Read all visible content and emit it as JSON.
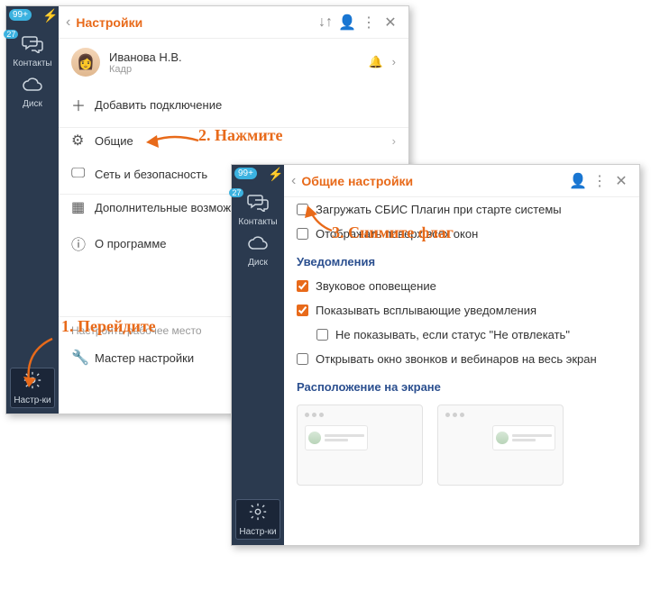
{
  "win1": {
    "badge": "99+",
    "sidebar": {
      "contacts": {
        "count": "27",
        "label": "Контакты"
      },
      "disk": {
        "label": "Диск"
      },
      "settings": {
        "label": "Настр-ки"
      }
    },
    "title": "Настройки",
    "user": {
      "name": "Иванова Н.В.",
      "dept": "Кадр"
    },
    "items": {
      "add_conn": "Добавить подключение",
      "general": "Общие",
      "net_sec": "Сеть и безопасность",
      "extra": "Дополнительные возможности",
      "about": "О программе"
    },
    "hint": "Настроить рабочее место",
    "wizard": "Мастер настройки"
  },
  "win2": {
    "badge": "99+",
    "sidebar": {
      "contacts": {
        "count": "27",
        "label": "Контакты"
      },
      "disk": {
        "label": "Диск"
      },
      "settings": {
        "label": "Настр-ки"
      }
    },
    "title": "Общие настройки",
    "opts": {
      "load_on_start": "Загружать СБИС Плагин при старте системы",
      "on_top": "Отображать поверх всех окон",
      "section_notif": "Уведомления",
      "sound": "Звуковое оповещение",
      "popups": "Показывать всплывающие уведомления",
      "dnd": "Не показывать, если статус \"Не отвлекать\"",
      "fullscreen_calls": "Открывать окно звонков и вебинаров на весь экран",
      "section_pos": "Расположение на экране"
    },
    "checked": {
      "sound": true,
      "popups": true
    }
  },
  "annot": {
    "a1": "1. Перейдите",
    "a2": "2. Нажмите",
    "a3": "3. Снимите флаг"
  }
}
